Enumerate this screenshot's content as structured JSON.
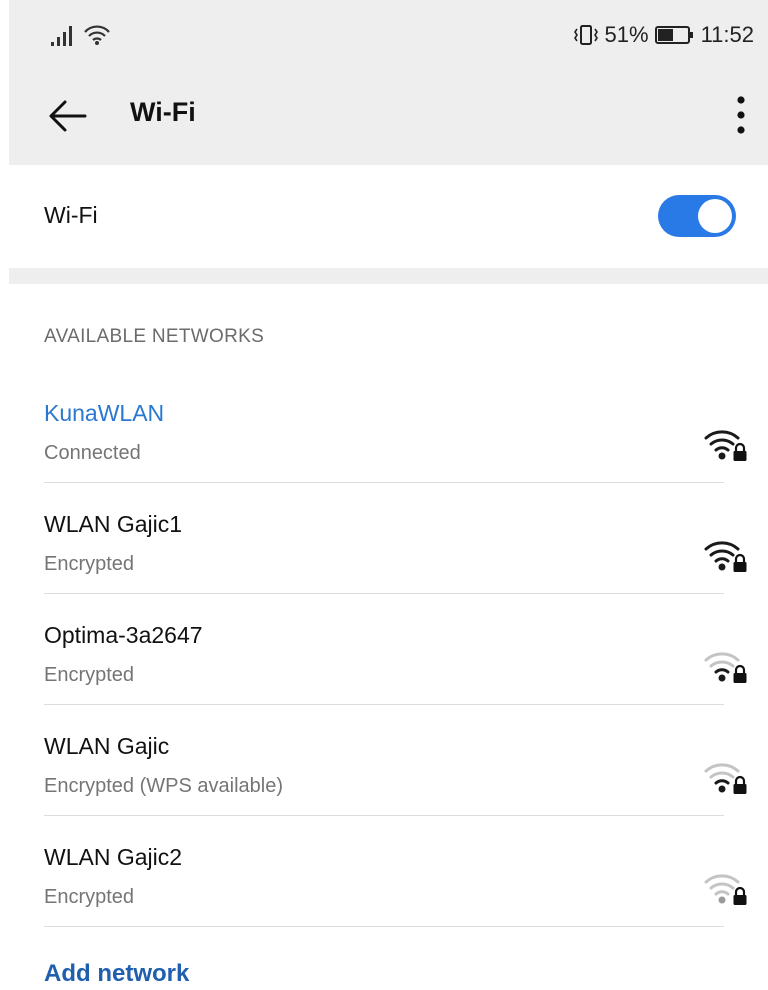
{
  "status_bar": {
    "battery_percent": "51%",
    "time": "11:52",
    "battery_level": 0.51
  },
  "app_bar": {
    "title": "Wi-Fi"
  },
  "wifi_toggle": {
    "label": "Wi-Fi",
    "enabled": true,
    "accent_color": "#2979e6"
  },
  "available_networks": {
    "header": "AVAILABLE NETWORKS",
    "items": [
      {
        "name": "KunaWLAN",
        "status": "Connected",
        "signal_bars": 3,
        "secured": true,
        "connected": true
      },
      {
        "name": "WLAN Gajic1",
        "status": "Encrypted",
        "signal_bars": 3,
        "secured": true,
        "connected": false
      },
      {
        "name": "Optima-3a2647",
        "status": "Encrypted",
        "signal_bars": 1,
        "secured": true,
        "connected": false
      },
      {
        "name": "WLAN Gajic",
        "status": "Encrypted (WPS available)",
        "signal_bars": 1,
        "secured": true,
        "connected": false
      },
      {
        "name": "WLAN Gajic2",
        "status": "Encrypted",
        "signal_bars": 0,
        "secured": true,
        "connected": false
      }
    ]
  },
  "add_network_label": "Add network"
}
